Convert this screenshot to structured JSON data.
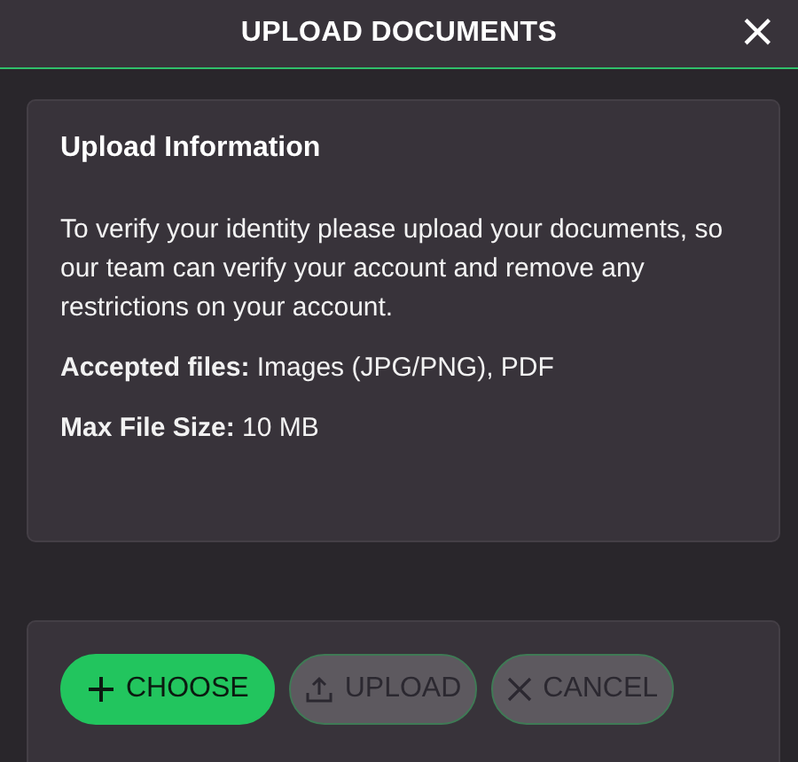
{
  "window": {
    "title": "UPLOAD DOCUMENTS",
    "close": "×"
  },
  "info": {
    "title": "Upload Information",
    "paragraphs": [
      "To verify your identity please upload your documents, so our team can verify your account and remove any restrictions on your account.",
      "**Accepted files:** Images (JPG/PNG), PDF",
      "**Max File Size:** 10 MB"
    ]
  },
  "buttons": [
    {
      "kind": "choose",
      "label": "CHOOSE",
      "disabled": false
    },
    {
      "kind": "upload",
      "label": "UPLOAD",
      "disabled": true
    },
    {
      "kind": "cancel",
      "label": "CANCEL",
      "disabled": true
    }
  ]
}
